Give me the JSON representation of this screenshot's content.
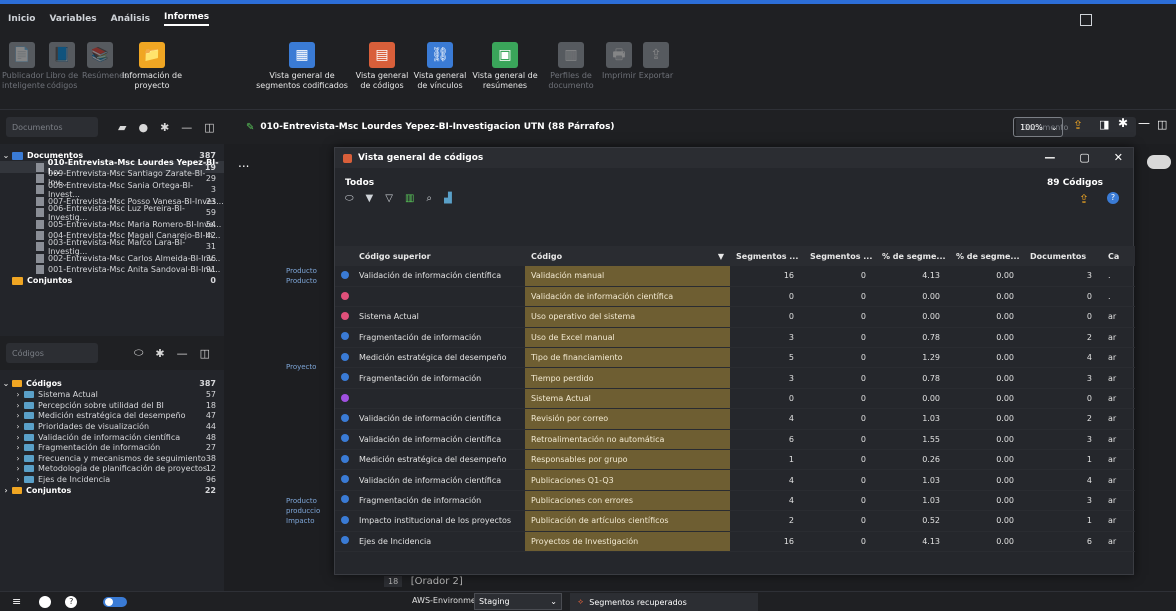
{
  "menu": {
    "items": [
      "Inicio",
      "Variables",
      "Análisis",
      "Informes"
    ],
    "active": "Informes"
  },
  "ribbon": [
    {
      "label": "Publicador inteligente",
      "dim": true,
      "color": "#9aa0a8",
      "icon": "📄"
    },
    {
      "label": "Libro de códigos",
      "dim": true,
      "color": "#9aa0a8",
      "icon": "📘"
    },
    {
      "label": "Resúmenes",
      "dim": true,
      "color": "#9aa0a8",
      "icon": "📚"
    },
    {
      "label": "Información de proyecto",
      "dim": false,
      "color": "#f0a623",
      "icon": "📁"
    },
    {
      "label": "Vista general de segmentos codificados",
      "dim": false,
      "color": "#3a7bd5",
      "icon": "▦"
    },
    {
      "label": "Vista general de códigos",
      "dim": false,
      "color": "#d95f3a",
      "icon": "▤"
    },
    {
      "label": "Vista general de vínculos",
      "dim": false,
      "color": "#3a7bd5",
      "icon": "⛓"
    },
    {
      "label": "Vista general de resúmenes",
      "dim": false,
      "color": "#3aa55a",
      "icon": "▣"
    },
    {
      "label": "Perfiles de documento",
      "dim": true,
      "color": "#9aa0a8",
      "icon": "▥"
    },
    {
      "label": "Imprimir",
      "dim": true,
      "color": "#9aa0a8",
      "icon": "🖶"
    },
    {
      "label": "Exportar",
      "dim": true,
      "color": "#9aa0a8",
      "icon": "⇪"
    }
  ],
  "documents_panel": {
    "search_placeholder": "Documentos",
    "root": {
      "label": "Documentos",
      "count": "387"
    },
    "items": [
      {
        "label": "010-Entrevista-Msc Lourdes Yepez-BI-I...",
        "count": "19",
        "bold": true
      },
      {
        "label": "009-Entrevista-Msc Santiago Zarate-BI-Inv...",
        "count": "29"
      },
      {
        "label": "008-Entrevista-Msc Sania Ortega-BI-Invest...",
        "count": "3"
      },
      {
        "label": "007-Entrevista-Msc Posso Vanesa-BI-Inves...",
        "count": "23"
      },
      {
        "label": "006-Entrevista-Msc Luz Pereira-BI-Investig...",
        "count": "59"
      },
      {
        "label": "005-Entrevista-Msc Maria Romero-BI-Inve...",
        "count": "54"
      },
      {
        "label": "004-Entrevista-Msc Magali Canarejo-BI-In...",
        "count": "42"
      },
      {
        "label": "003-Entrevista-Msc Marco Lara-BI-Investig...",
        "count": "31"
      },
      {
        "label": "002-Entrevista-Msc Carlos Almeida-BI-Inv...",
        "count": "36"
      },
      {
        "label": "001-Entrevista-Msc Anita Sandoval-BI-Inv...",
        "count": "91"
      }
    ],
    "sets": {
      "label": "Conjuntos",
      "count": "0"
    }
  },
  "codes_panel": {
    "search_placeholder": "Códigos",
    "root": {
      "label": "Códigos",
      "count": "387"
    },
    "items": [
      {
        "label": "Sistema Actual",
        "count": "57"
      },
      {
        "label": "Percepción sobre utilidad del BI",
        "count": "18"
      },
      {
        "label": "Medición estratégica del desempeño",
        "count": "47"
      },
      {
        "label": "Prioridades de visualización",
        "count": "44"
      },
      {
        "label": "Validación de información científica",
        "count": "48"
      },
      {
        "label": "Fragmentación de información",
        "count": "27"
      },
      {
        "label": "Frecuencia y mecanismos de seguimiento",
        "count": "38"
      },
      {
        "label": "Metodología de planificación de proyectos",
        "count": "12"
      },
      {
        "label": "Ejes de Incidencia",
        "count": "96"
      }
    ],
    "sets": {
      "label": "Conjuntos",
      "count": "22"
    }
  },
  "document_view": {
    "title": "010-Entrevista-Msc Lourdes Yepez-BI-Investigacion UTN  (88 Párrafos)",
    "search_placeholder": "Documento",
    "zoom": "100%",
    "more": "...",
    "side_labels": [
      "Producto",
      "Producto",
      "Proyecto",
      "Producto",
      "produccio",
      "Impacto"
    ],
    "footer_num": "18",
    "footer_text": "[Orador 2]"
  },
  "dialog": {
    "title": "Vista general de códigos",
    "filter_label": "Todos",
    "count_label": "89 Códigos",
    "columns": [
      "Código superior",
      "Código",
      "Segmentos ...",
      "Segmentos ...",
      "% de segme...",
      "% de segme...",
      "Documentos",
      "Ca"
    ],
    "rows": [
      {
        "dot": "#3a7bd5",
        "parent": "Validación de información científica",
        "code": "Validación manual",
        "seg1": "16",
        "seg2": "0",
        "pct1": "4.13",
        "pct2": "0.00",
        "docs": "3",
        "extra": "."
      },
      {
        "dot": "#e0507a",
        "parent": "",
        "code": "Validación de información científica",
        "seg1": "0",
        "seg2": "0",
        "pct1": "0.00",
        "pct2": "0.00",
        "docs": "0",
        "extra": "."
      },
      {
        "dot": "#e0507a",
        "parent": "Sistema Actual",
        "code": "Uso operativo del sistema",
        "seg1": "0",
        "seg2": "0",
        "pct1": "0.00",
        "pct2": "0.00",
        "docs": "0",
        "extra": "ar"
      },
      {
        "dot": "#3a7bd5",
        "parent": "Fragmentación de información",
        "code": "Uso de Excel manual",
        "seg1": "3",
        "seg2": "0",
        "pct1": "0.78",
        "pct2": "0.00",
        "docs": "2",
        "extra": "ar"
      },
      {
        "dot": "#3a7bd5",
        "parent": "Medición estratégica del desempeño",
        "code": "Tipo de financiamiento",
        "seg1": "5",
        "seg2": "0",
        "pct1": "1.29",
        "pct2": "0.00",
        "docs": "4",
        "extra": "ar"
      },
      {
        "dot": "#3a7bd5",
        "parent": "Fragmentación de información",
        "code": "Tiempo perdido",
        "seg1": "3",
        "seg2": "0",
        "pct1": "0.78",
        "pct2": "0.00",
        "docs": "3",
        "extra": "ar"
      },
      {
        "dot": "#a050e0",
        "parent": "",
        "code": "Sistema Actual",
        "seg1": "0",
        "seg2": "0",
        "pct1": "0.00",
        "pct2": "0.00",
        "docs": "0",
        "extra": "ar"
      },
      {
        "dot": "#3a7bd5",
        "parent": "Validación de información científica",
        "code": "Revisión por correo",
        "seg1": "4",
        "seg2": "0",
        "pct1": "1.03",
        "pct2": "0.00",
        "docs": "2",
        "extra": "ar"
      },
      {
        "dot": "#3a7bd5",
        "parent": "Validación de información científica",
        "code": "Retroalimentación no automática",
        "seg1": "6",
        "seg2": "0",
        "pct1": "1.55",
        "pct2": "0.00",
        "docs": "3",
        "extra": "ar"
      },
      {
        "dot": "#3a7bd5",
        "parent": "Medición estratégica del desempeño",
        "code": "Responsables por grupo",
        "seg1": "1",
        "seg2": "0",
        "pct1": "0.26",
        "pct2": "0.00",
        "docs": "1",
        "extra": "ar"
      },
      {
        "dot": "#3a7bd5",
        "parent": "Validación de información científica",
        "code": "Publicaciones Q1-Q3",
        "seg1": "4",
        "seg2": "0",
        "pct1": "1.03",
        "pct2": "0.00",
        "docs": "4",
        "extra": "ar"
      },
      {
        "dot": "#3a7bd5",
        "parent": "Fragmentación de información",
        "code": "Publicaciones con errores",
        "seg1": "4",
        "seg2": "0",
        "pct1": "1.03",
        "pct2": "0.00",
        "docs": "3",
        "extra": "ar"
      },
      {
        "dot": "#3a7bd5",
        "parent": "Impacto institucional de los proyectos",
        "code": "Publicación de artículos científicos",
        "seg1": "2",
        "seg2": "0",
        "pct1": "0.52",
        "pct2": "0.00",
        "docs": "1",
        "extra": "ar"
      },
      {
        "dot": "#3a7bd5",
        "parent": "Ejes de Incidencia",
        "code": "Proyectos de Investigación",
        "seg1": "16",
        "seg2": "0",
        "pct1": "4.13",
        "pct2": "0.00",
        "docs": "6",
        "extra": "ar"
      }
    ]
  },
  "status": {
    "env_label": "AWS-Environment:",
    "env_value": "Staging",
    "seg_recovered": "Segmentos recuperados"
  }
}
